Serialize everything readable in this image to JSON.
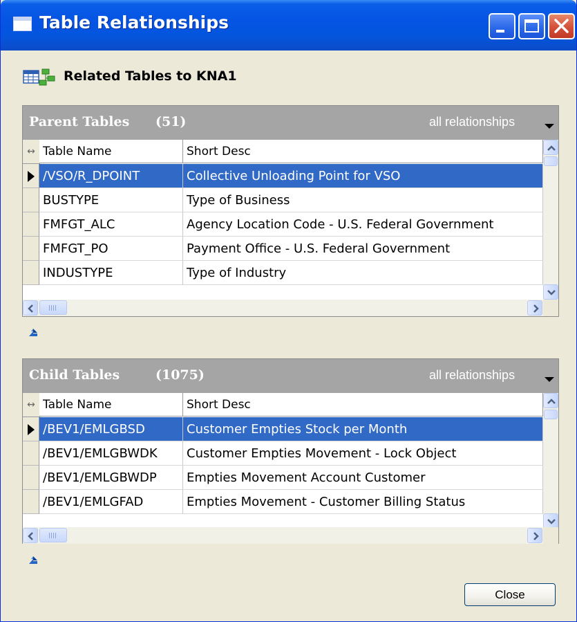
{
  "window": {
    "title": "Table Relationships",
    "title_color": "#0554E3",
    "buttons": [
      "minimize",
      "maximize",
      "close"
    ]
  },
  "related": {
    "icon": "related-tables-icon",
    "label": "Related Tables to KNA1"
  },
  "parent": {
    "title": "Parent Tables",
    "count": "(51)",
    "filter": "all relationships",
    "columns": [
      "Table Name",
      "Short Desc"
    ],
    "rows": [
      {
        "name": "/VSO/R_DPOINT",
        "desc": "Collective Unloading Point for VSO",
        "selected": true
      },
      {
        "name": "BUSTYPE",
        "desc": "Type of Business",
        "selected": false
      },
      {
        "name": "FMFGT_ALC",
        "desc": "Agency Location Code - U.S. Federal Government",
        "selected": false
      },
      {
        "name": "FMFGT_PO",
        "desc": "Payment Office - U.S. Federal Government",
        "selected": false
      },
      {
        "name": "INDUSTYPE",
        "desc": "Type of Industry",
        "selected": false
      }
    ]
  },
  "child": {
    "title": "Child Tables",
    "count": "(1075)",
    "filter": "all relationships",
    "columns": [
      "Table Name",
      "Short Desc"
    ],
    "rows": [
      {
        "name": "/BEV1/EMLGBSD",
        "desc": "Customer Empties Stock per Month",
        "selected": true
      },
      {
        "name": "/BEV1/EMLGBWDK",
        "desc": "Customer Empties Movement - Lock Object",
        "selected": false
      },
      {
        "name": "/BEV1/EMLGBWDP",
        "desc": "Empties Movement Account Customer",
        "selected": false
      },
      {
        "name": "/BEV1/EMLGFAD",
        "desc": "Empties Movement - Customer Billing Status",
        "selected": false
      }
    ]
  },
  "footer": {
    "close_label": "Close"
  },
  "colors": {
    "selection": "#3169C6",
    "panel_header": "#A5A5A5",
    "window_bg": "#ECE9D8"
  }
}
